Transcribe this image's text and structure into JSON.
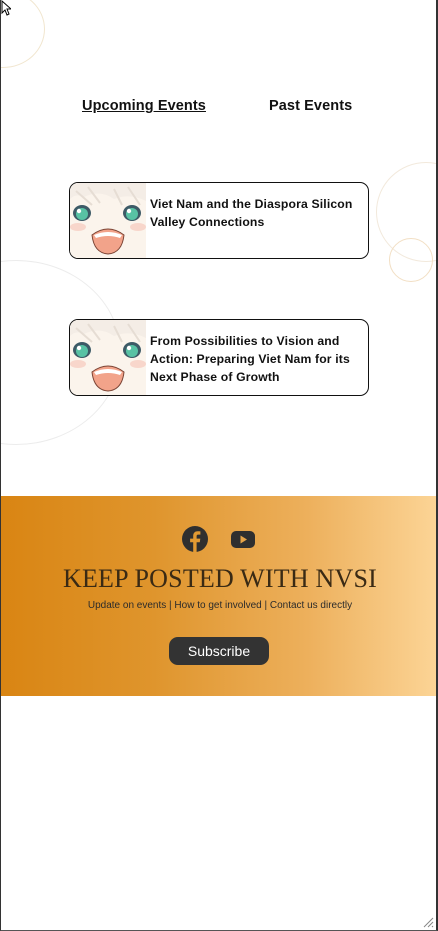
{
  "tabs": {
    "upcoming": "Upcoming Events",
    "past": "Past Events"
  },
  "events": [
    {
      "title": "Viet Nam and the Diaspora Silicon Valley Connections"
    },
    {
      "title": "From Possibilities to Vision and Action: Preparing Viet Nam for its Next Phase of Growth"
    }
  ],
  "banner": {
    "social_icons": [
      "facebook-icon",
      "youtube-icon"
    ],
    "title": "KEEP POSTED WITH NVSI",
    "subtitle": "Update on events | How to get involved | Contact us directly",
    "subscribe_label": "Subscribe"
  },
  "colors": {
    "banner_gradient_start": "#d98513",
    "banner_gradient_end": "#fcd597",
    "button_bg": "#333333",
    "text": "#111111"
  }
}
